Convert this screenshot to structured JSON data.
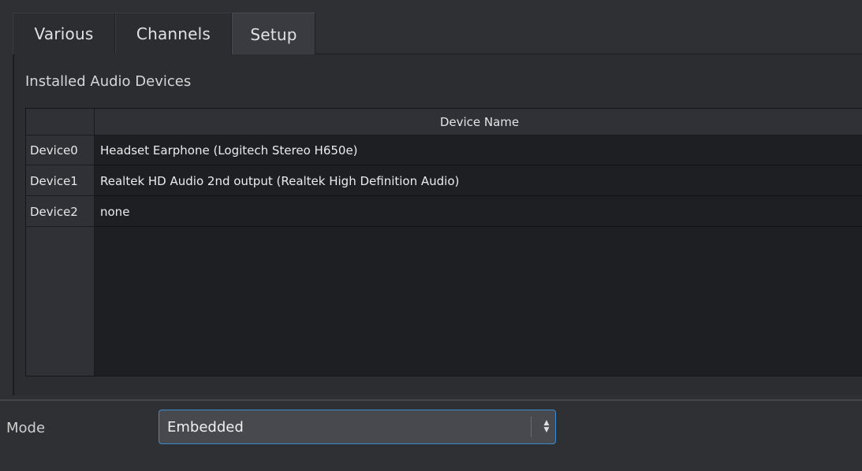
{
  "tabs": [
    {
      "label": "Various",
      "active": false
    },
    {
      "label": "Channels",
      "active": false
    },
    {
      "label": "Setup",
      "active": true
    }
  ],
  "group": {
    "title": "Installed Audio Devices"
  },
  "table": {
    "column_header": "Device Name",
    "rows": [
      {
        "header": "Device0",
        "value": "Headset Earphone (Logitech Stereo H650e)"
      },
      {
        "header": "Device1",
        "value": "Realtek HD Audio 2nd output (Realtek High Definition Audio)"
      },
      {
        "header": "Device2",
        "value": "none"
      }
    ]
  },
  "mode": {
    "label": "Mode",
    "selected": "Embedded"
  },
  "colors": {
    "accent_border": "#3f8bd0",
    "background": "#2f3034",
    "table_bg": "#1e1f23"
  },
  "icons": {
    "select_arrows": "updown-chevron-icon"
  }
}
